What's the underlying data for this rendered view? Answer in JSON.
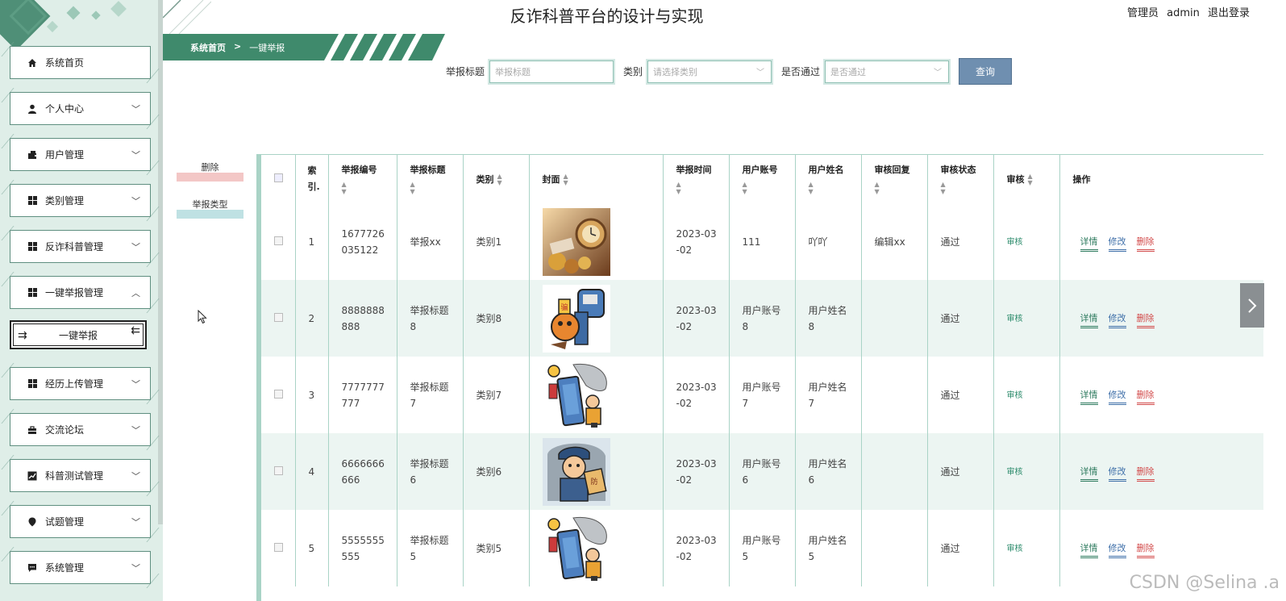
{
  "header": {
    "title": "反诈科普平台的设计与实现",
    "role": "管理员",
    "username": "admin",
    "logout": "退出登录"
  },
  "breadcrumb": {
    "home": "系统首页",
    "separator": ">",
    "current": "一键举报"
  },
  "sidebar": {
    "items": [
      {
        "label": "系统首页",
        "icon": "home-icon"
      },
      {
        "label": "个人中心",
        "icon": "user-icon"
      },
      {
        "label": "用户管理",
        "icon": "users-icon"
      },
      {
        "label": "类别管理",
        "icon": "grid-icon"
      },
      {
        "label": "反诈科普管理",
        "icon": "grid-icon"
      },
      {
        "label": "一键举报管理",
        "icon": "grid-icon"
      },
      {
        "label": "经历上传管理",
        "icon": "grid-icon"
      },
      {
        "label": "交流论坛",
        "icon": "briefcase-icon"
      },
      {
        "label": "科普测试管理",
        "icon": "chart-icon"
      },
      {
        "label": "试题管理",
        "icon": "pin-icon"
      },
      {
        "label": "系统管理",
        "icon": "message-icon"
      }
    ],
    "sub_item": "一键举报"
  },
  "search": {
    "title_label": "举报标题",
    "title_placeholder": "举报标题",
    "category_label": "类别",
    "category_placeholder": "请选择类别",
    "pass_label": "是否通过",
    "pass_placeholder": "是否通过",
    "button": "查询"
  },
  "actions": {
    "delete": "删除",
    "type": "举报类型"
  },
  "table": {
    "headers": {
      "index": "索引.",
      "report_no": "举报编号",
      "report_title": "举报标题",
      "category": "类别",
      "cover": "封面",
      "report_time": "举报时间",
      "user_account": "用户账号",
      "user_name": "用户姓名",
      "review_reply": "审核回复",
      "review_status": "审核状态",
      "review": "审核",
      "ops": "操作"
    },
    "rows": [
      {
        "index": "1",
        "report_no": "1677726035122",
        "title": "举报xx",
        "category": "类别1",
        "time": "2023-03-02",
        "account": "111",
        "name": "吖吖",
        "reply": "编辑xx",
        "status": "通过",
        "review": "审核",
        "cover": "coins-clock-photo"
      },
      {
        "index": "2",
        "report_no": "8888888888",
        "title": "举报标题8",
        "category": "类别8",
        "time": "2023-03-02",
        "account": "用户账号8",
        "name": "用户姓名8",
        "reply": "",
        "status": "通过",
        "review": "审核",
        "cover": "anti-fraud-fist-cartoon"
      },
      {
        "index": "3",
        "report_no": "7777777777",
        "title": "举报标题7",
        "category": "类别7",
        "time": "2023-03-02",
        "account": "用户账号7",
        "name": "用户姓名7",
        "reply": "",
        "status": "通过",
        "review": "审核",
        "cover": "phone-scam-cartoon"
      },
      {
        "index": "4",
        "report_no": "6666666666",
        "title": "举报标题6",
        "category": "类别6",
        "time": "2023-03-02",
        "account": "用户账号6",
        "name": "用户姓名6",
        "reply": "",
        "status": "通过",
        "review": "审核",
        "cover": "police-cartoon"
      },
      {
        "index": "5",
        "report_no": "5555555555",
        "title": "举报标题5",
        "category": "类别5",
        "time": "2023-03-02",
        "account": "用户账号5",
        "name": "用户姓名5",
        "reply": "",
        "status": "通过",
        "review": "审核",
        "cover": "phone-scam-cartoon"
      }
    ],
    "op_detail": "详情",
    "op_edit": "修改",
    "op_delete": "删除"
  },
  "watermark": "CSDN @Selina .a",
  "colors": {
    "sidebar_bg": "#dfeee8",
    "brand_green": "#3f8a6c",
    "table_border": "#a9d3c6",
    "stripe_row": "#ecf5f2",
    "search_button": "#6f8fb0"
  }
}
